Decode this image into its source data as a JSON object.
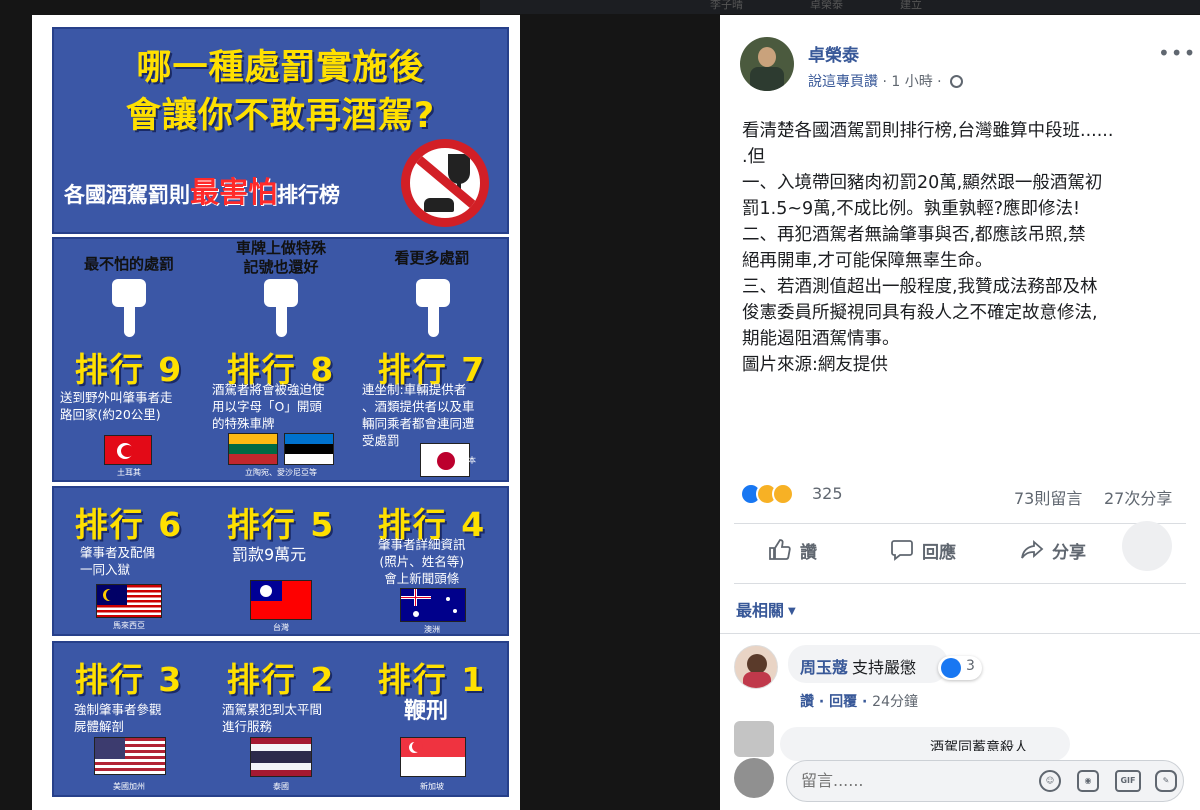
{
  "backdrop": {
    "topstrip_fragments": [
      "李子晴",
      "卓榮泰",
      "建立"
    ]
  },
  "poster": {
    "title_line1": "哪一種處罰實施後",
    "title_line2": "會讓你不敢再酒駕?",
    "ranking_prefix": "各國酒駕罰則",
    "ranking_highlight": "最害怕",
    "ranking_suffix": "排行榜",
    "headers": [
      "最不怕的處罰",
      "車牌上做特殊\n記號也還好",
      "看更多處罰"
    ],
    "items": [
      {
        "rank": "排行 9",
        "desc": "送到野外叫肇事者走\n路回家(約20公里)",
        "flag_caption": "土耳其"
      },
      {
        "rank": "排行 8",
        "desc": "酒駕者將會被強迫使\n用以字母「O」開頭\n的特殊車牌",
        "flag_caption": "立陶宛、愛沙尼亞等"
      },
      {
        "rank": "排行 7",
        "desc": "連坐制:車輛提供者\n、酒類提供者以及車\n輛同乘者都會連同遭\n受處罰",
        "flag_caption": "日本"
      },
      {
        "rank": "排行 6",
        "desc": "肇事者及配偶\n一同入獄",
        "flag_caption": "馬來西亞"
      },
      {
        "rank": "排行 5",
        "desc": "罰款9萬元",
        "flag_caption": "台灣"
      },
      {
        "rank": "排行 4",
        "desc": "肇事者詳細資訊\n(照片、姓名等)\n會上新聞頭條",
        "flag_caption": "澳洲"
      },
      {
        "rank": "排行 3",
        "desc": "強制肇事者參觀\n屍體解剖",
        "flag_caption": "美國加州"
      },
      {
        "rank": "排行 2",
        "desc": "酒駕累犯到太平間\n進行服務",
        "flag_caption": "泰國"
      },
      {
        "rank": "排行 1",
        "desc": "鞭刑",
        "flag_caption": "新加坡"
      }
    ]
  },
  "post": {
    "author": "卓榮泰",
    "meta_like": "說這專頁讚",
    "meta_time": " · 1 小時 · ",
    "more": "•••",
    "body": "看清楚各國酒駕罰則排行榜,台灣雖算中段班......\n.但\n一、入境帶回豬肉初罰20萬,顯然跟一般酒駕初\n罰1.5~9萬,不成比例。孰重孰輕?應即修法!\n二、再犯酒駕者無論肇事與否,都應該吊照,禁\n絕再開車,才可能保障無辜生命。\n三、若酒測值超出一般程度,我贊成法務部及林\n俊憲委員所擬視同具有殺人之不確定故意修法,\n期能遏阻酒駕情事。\n圖片來源:網友提供",
    "reaction_count": "325",
    "comment_count": "73則留言",
    "share_count": "27次分享",
    "actions": {
      "like": "讚",
      "comment": "回應",
      "share": "分享"
    },
    "sort_label": "最相關"
  },
  "comments": [
    {
      "author": "周玉蔻",
      "text": "支持嚴懲",
      "reaction_count": "3",
      "like": "讚",
      "reply": "回覆",
      "time": "24分鐘"
    },
    {
      "text": "酒駕同蓄意殺人"
    }
  ],
  "composer": {
    "placeholder": "留言......",
    "gif_label": "GIF"
  },
  "colors": {
    "poster_blue": "#3b57a6",
    "poster_yellow": "#ffe000",
    "fb_link": "#385898",
    "fb_like": "#1877f2"
  }
}
